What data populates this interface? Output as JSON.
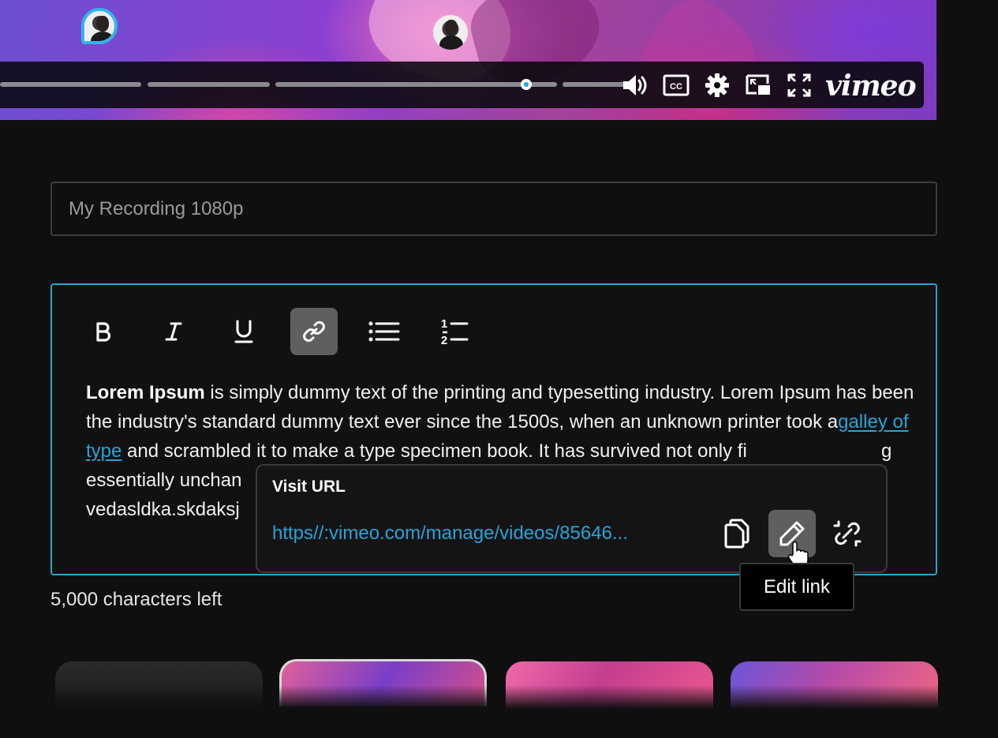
{
  "player": {
    "brand": "vimeo",
    "controls": [
      "volume-icon",
      "closed-captions-icon",
      "settings-icon",
      "picture-in-picture-icon",
      "fullscreen-icon"
    ],
    "accent_color": "#1aa6e0"
  },
  "title_field": {
    "placeholder": "My Recording 1080p",
    "value": ""
  },
  "editor": {
    "toolbar": [
      "bold-icon",
      "italic-icon",
      "underline-icon",
      "link-icon",
      "bullet-list-icon",
      "numbered-list-icon"
    ],
    "active_tool": "link-icon",
    "body": {
      "bold_lead": "Lorem Ipsum",
      "text_1": " is simply dummy text of the printing and typesetting industry. Lorem Ipsum has been the industry's standard dummy text ever since the 1500s, when an unknown printer took a",
      "link_text": "galley of type",
      "text_2": " and scrambled it to make a type specimen book. It has survived not only fi",
      "text_3": "essentially unchan",
      "text_3_end": "g",
      "text_4": "vedasldka.skdaksj"
    },
    "border_color": "#2aa3d6"
  },
  "counter": "5,000 characters left",
  "link_popover": {
    "label": "Visit URL",
    "url": "https//:vimeo.com/manage/videos/85646...",
    "actions": [
      "copy-icon",
      "edit-icon",
      "unlink-icon"
    ],
    "active_action": "edit-icon"
  },
  "tooltip": "Edit link"
}
